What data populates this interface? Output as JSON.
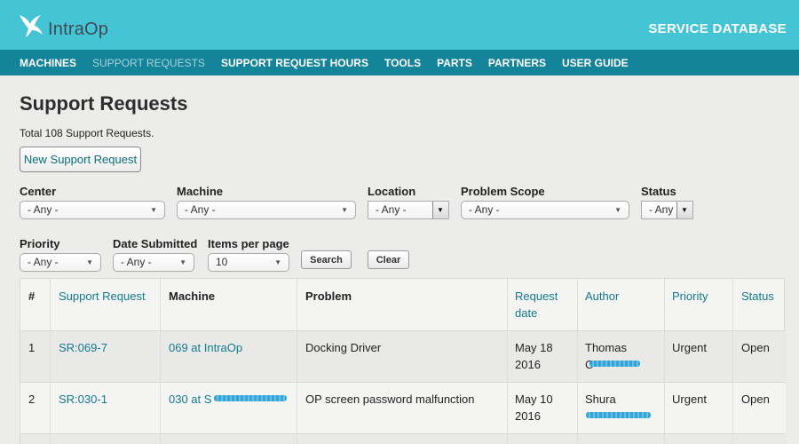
{
  "header": {
    "logo_text": "IntraOp",
    "service_title": "SERVICE DATABASE"
  },
  "nav": {
    "items": [
      {
        "label": "MACHINES"
      },
      {
        "label": "SUPPORT REQUESTS"
      },
      {
        "label": "SUPPORT REQUEST HOURS"
      },
      {
        "label": "TOOLS"
      },
      {
        "label": "PARTS"
      },
      {
        "label": "PARTNERS"
      },
      {
        "label": "USER GUIDE"
      }
    ]
  },
  "page": {
    "title": "Support Requests",
    "total": "Total 108 Support Requests.",
    "new_button": "New Support Request"
  },
  "filters": {
    "center": {
      "label": "Center",
      "value": "- Any -"
    },
    "machine": {
      "label": "Machine",
      "value": "- Any -"
    },
    "location": {
      "label": "Location",
      "value": "- Any -"
    },
    "problem_scope": {
      "label": "Problem Scope",
      "value": "- Any -"
    },
    "status": {
      "label": "Status",
      "value": "- Any -"
    },
    "priority": {
      "label": "Priority",
      "value": "- Any -"
    },
    "date_submitted": {
      "label": "Date Submitted",
      "value": "- Any -"
    },
    "items_per_page": {
      "label": "Items per page",
      "value": "10"
    },
    "search_button": "Search",
    "clear_button": "Clear"
  },
  "table": {
    "headers": {
      "num": "#",
      "support_request": "Support Request",
      "machine": "Machine",
      "problem": "Problem",
      "request_date_1": "Request",
      "request_date_2": "date",
      "author": "Author",
      "priority": "Priority",
      "status": "Status"
    },
    "rows": [
      {
        "num": "1",
        "support_request": "SR:069-7",
        "machine": "069 at IntraOp",
        "problem": "Docking Driver",
        "date_1": "May 18",
        "date_2": "2016",
        "author_1": "Thomas",
        "author_2": "C",
        "priority": "Urgent",
        "status": "Open"
      },
      {
        "num": "2",
        "support_request": "SR:030-1",
        "machine": "030 at S",
        "problem": "OP screen password malfunction",
        "date_1": "May 10",
        "date_2": "2016",
        "author_1": "Shura",
        "author_2": "",
        "priority": "Urgent",
        "status": "Open"
      }
    ]
  },
  "colors": {
    "topbar": "#45c4d6",
    "navbar": "#14849a",
    "link": "#137a8e"
  }
}
